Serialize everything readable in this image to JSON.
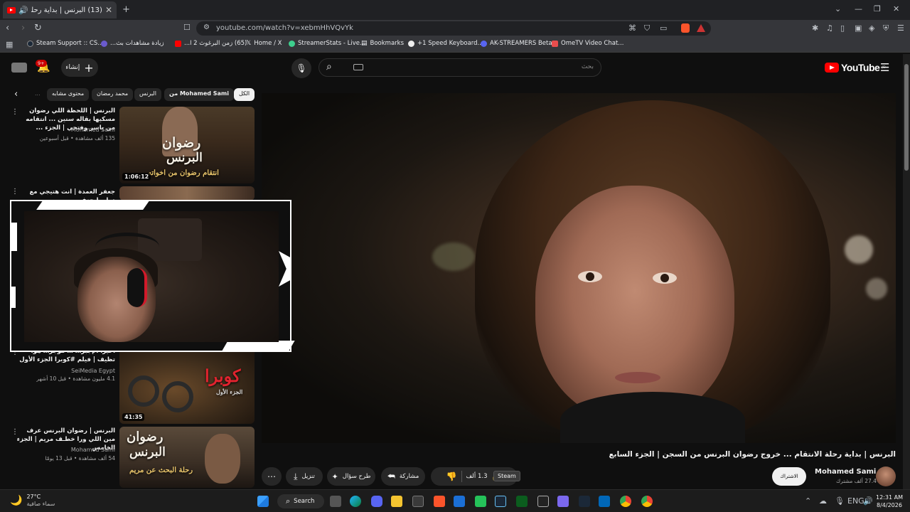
{
  "browser": {
    "tab_title": "(13) البرنس | بداية رحلة الانتقا...",
    "tab_close": "✕",
    "new_tab": "+",
    "url": "youtube.com/watch?v=xebmHhVQvYk",
    "window_controls": [
      "⌄",
      "—",
      "❐",
      "✕"
    ],
    "bookmarks": [
      {
        "label": "Steam Support :: CS...",
        "color": "#1b2838"
      },
      {
        "label": "زيادة مشاهدات بث...",
        "color": "#5865f2"
      },
      {
        "label": "(65) زمن البرغوث 2 ا...",
        "color": "#ff0000"
      },
      {
        "label": "Home / X",
        "color": "#000000"
      },
      {
        "label": "StreamerStats - Live...",
        "color": "#3ecf8e"
      },
      {
        "label": "Bookmarks",
        "color": "#888888"
      },
      {
        "label": "+1 Speed Keyboard...",
        "color": "#cccccc"
      },
      {
        "label": "AK-STREAMERS Beta",
        "color": "#5865f2"
      },
      {
        "label": "OmeTV Video Chat...",
        "color": "#e94d4d"
      }
    ]
  },
  "youtube": {
    "logo_text": "YouTube",
    "logo_region": "JO",
    "search_placeholder": "بحث",
    "create_label": "إنشاء",
    "notif_count": "9+",
    "chips": [
      "الكل",
      "من Mohamed Sami",
      "البرنس",
      "محمد رمضان",
      "محتوى مشابه",
      "..."
    ],
    "video": {
      "title": "البرنس | بداية رحلة الانتقام ... خروج رضوان البرنس من السجن | الجزء السابع",
      "channel": "Mohamed Sami",
      "subscribers": "27.4 ألف مشترك",
      "subscribe_label": "الاشتراك",
      "likes": "1.3 ألف",
      "share_label": "مشاركة",
      "ask_label": "طرح سؤال",
      "download_label": "تنزيل",
      "tooltip": "Steam"
    },
    "sidebar": [
      {
        "title": "البرنس | اللحظة اللي رضوان مسكيها بقاله سنين ... انتقامه من ياسر وفتحي | الجزء ...",
        "channel": "Mohamed Sami",
        "meta": "135 ألف مشاهدة • قبل أسبوعين",
        "duration": "1:06:12",
        "thumb_text_1": "رضوان",
        "thumb_text_2": "البرنس",
        "thumb_sub": "انتقام رضوان من اخواته"
      },
      {
        "title": "جعفر العمدة | انت هتيجي مع دول يا جعفر",
        "channel": "",
        "meta": "",
        "duration": ""
      },
      {
        "title": "أخيرا الإجبر… … موجز… هوا تظيف | فيلم #كوبرا الجزء الأول",
        "channel": "SeiMedia Egypt",
        "meta": "4.1 مليون مشاهدة • قبل 10 أشهر",
        "duration": "41:35",
        "thumb_text_1": "كوبرا",
        "thumb_sub": "الجزء الأول"
      },
      {
        "title": "البرنس | رضوان البرنس عرف مين اللي ورا خطـف مريم | الجزء الخامس",
        "channel": "Mohamed Sami",
        "meta": "54 ألف مشاهدة • قبل 13 يومًا",
        "duration": "",
        "thumb_text_1": "رضوان",
        "thumb_text_2": "البرنس",
        "thumb_sub": "رحلة البحث عن مريم"
      }
    ]
  },
  "taskbar": {
    "weather_temp": "27°C",
    "weather_desc": "سماء صافية",
    "search_label": "Search",
    "time": "12:31 AM",
    "date": "8/4/2026",
    "lang": "ENG"
  }
}
